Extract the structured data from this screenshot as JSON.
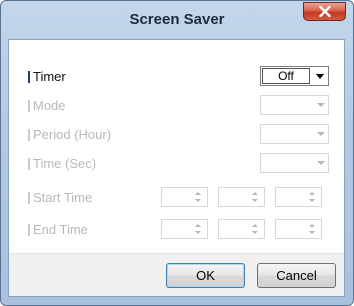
{
  "window": {
    "title": "Screen Saver",
    "close_icon": "close-x-icon"
  },
  "settings": {
    "timer": {
      "label": "Timer",
      "value": "Off",
      "enabled": true
    },
    "mode": {
      "label": "Mode",
      "value": "",
      "enabled": false
    },
    "period": {
      "label": "Period (Hour)",
      "value": "",
      "enabled": false
    },
    "time": {
      "label": "Time (Sec)",
      "value": "",
      "enabled": false
    },
    "start_time": {
      "label": "Start Time",
      "enabled": false
    },
    "end_time": {
      "label": "End Time",
      "enabled": false
    }
  },
  "buttons": {
    "ok": "OK",
    "cancel": "Cancel"
  },
  "colors": {
    "title_bar": "#b4cae3",
    "close_button": "#c23b22",
    "label_accent": "#1b3f72",
    "disabled_text": "#b9b9b9"
  }
}
